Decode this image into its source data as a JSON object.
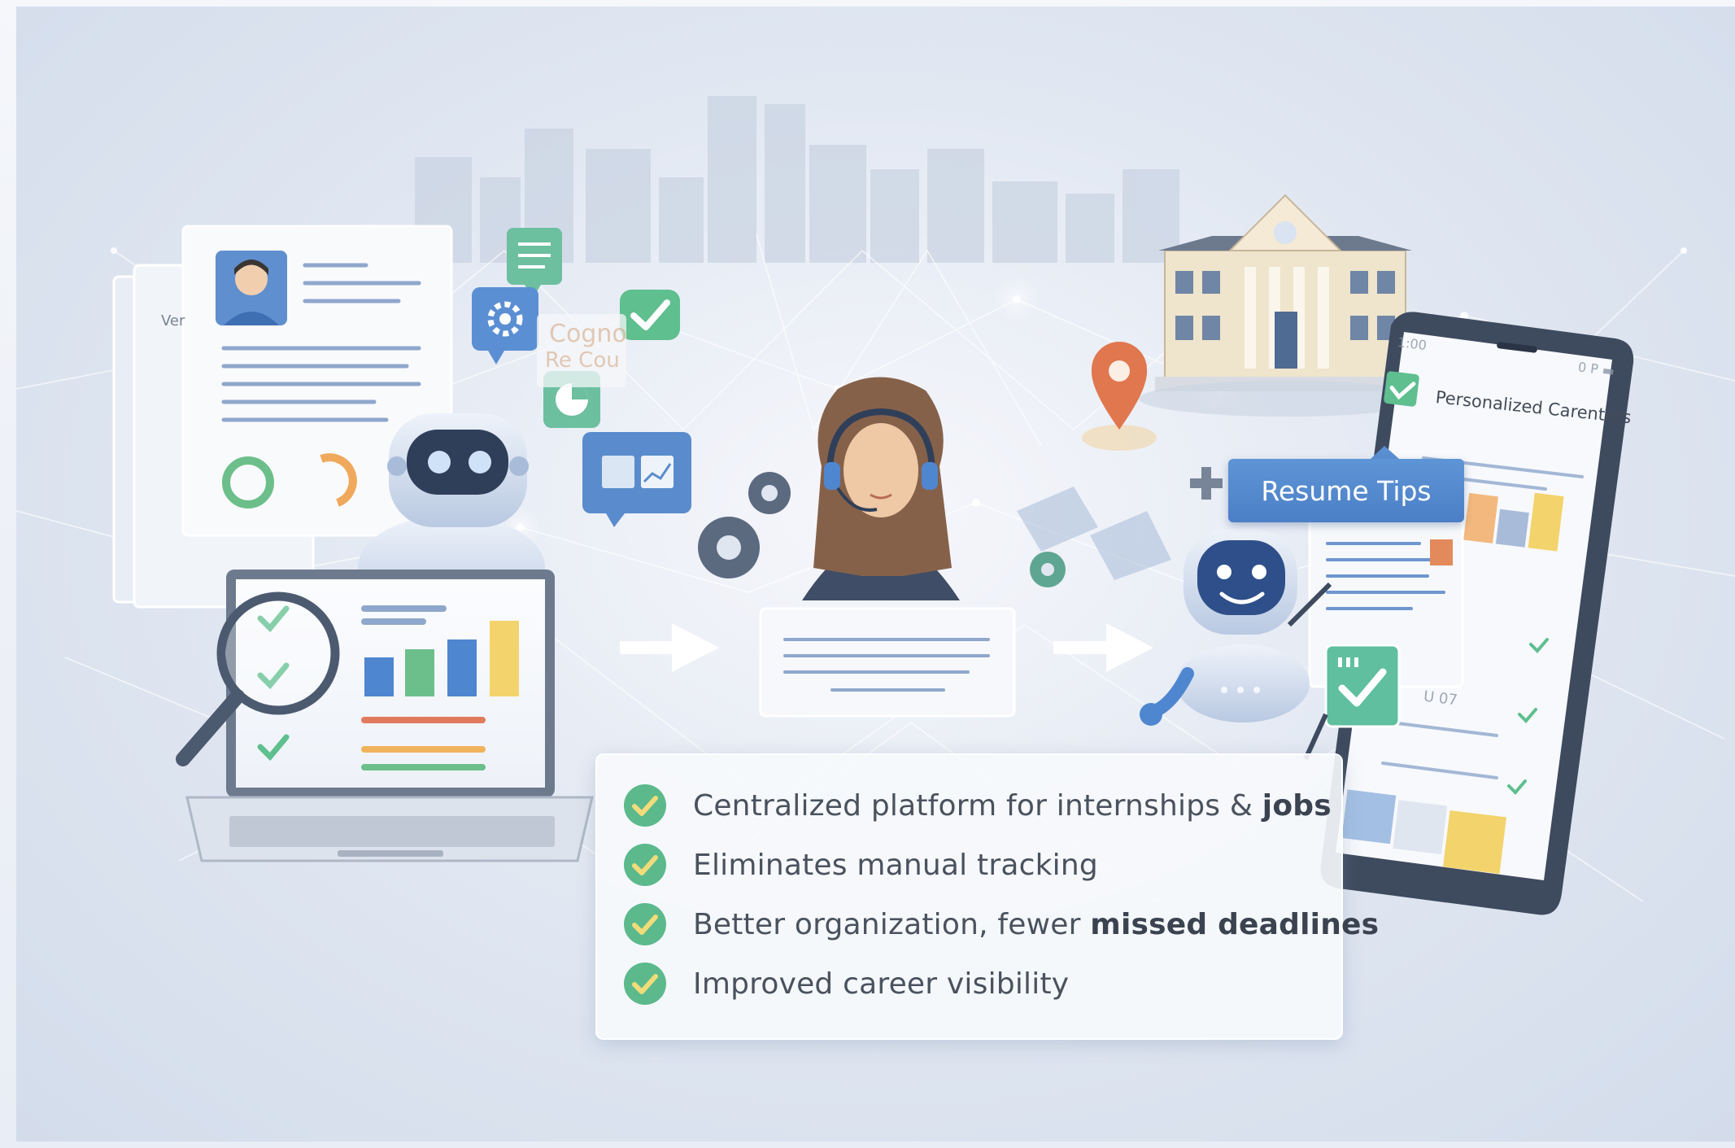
{
  "checklist": {
    "items": [
      {
        "text": "Centralized platform for internships & ",
        "emphasis": "jobs"
      },
      {
        "text": "Eliminates manual tracking",
        "emphasis": ""
      },
      {
        "text": "Better organization, fewer ",
        "emphasis": "missed deadlines"
      },
      {
        "text": "Improved career visibility",
        "emphasis": ""
      }
    ]
  },
  "phone": {
    "title": "Personalized Carenters",
    "status_left": "1:00",
    "status_right": "0 P ▬",
    "card_text": "U 07"
  },
  "banner": {
    "label": "Resume Tips"
  },
  "faded_doc": {
    "line1": "Cogno",
    "line2": "Re Cou",
    "side_label": "Ver"
  },
  "colors": {
    "check_green": "#5bb98c",
    "banner_blue": "#5a8fd2",
    "pin_orange": "#e0774f",
    "bar_blue": "#4f86d0",
    "bar_green": "#6cbf8a",
    "bar_yellow": "#f3d36b"
  }
}
